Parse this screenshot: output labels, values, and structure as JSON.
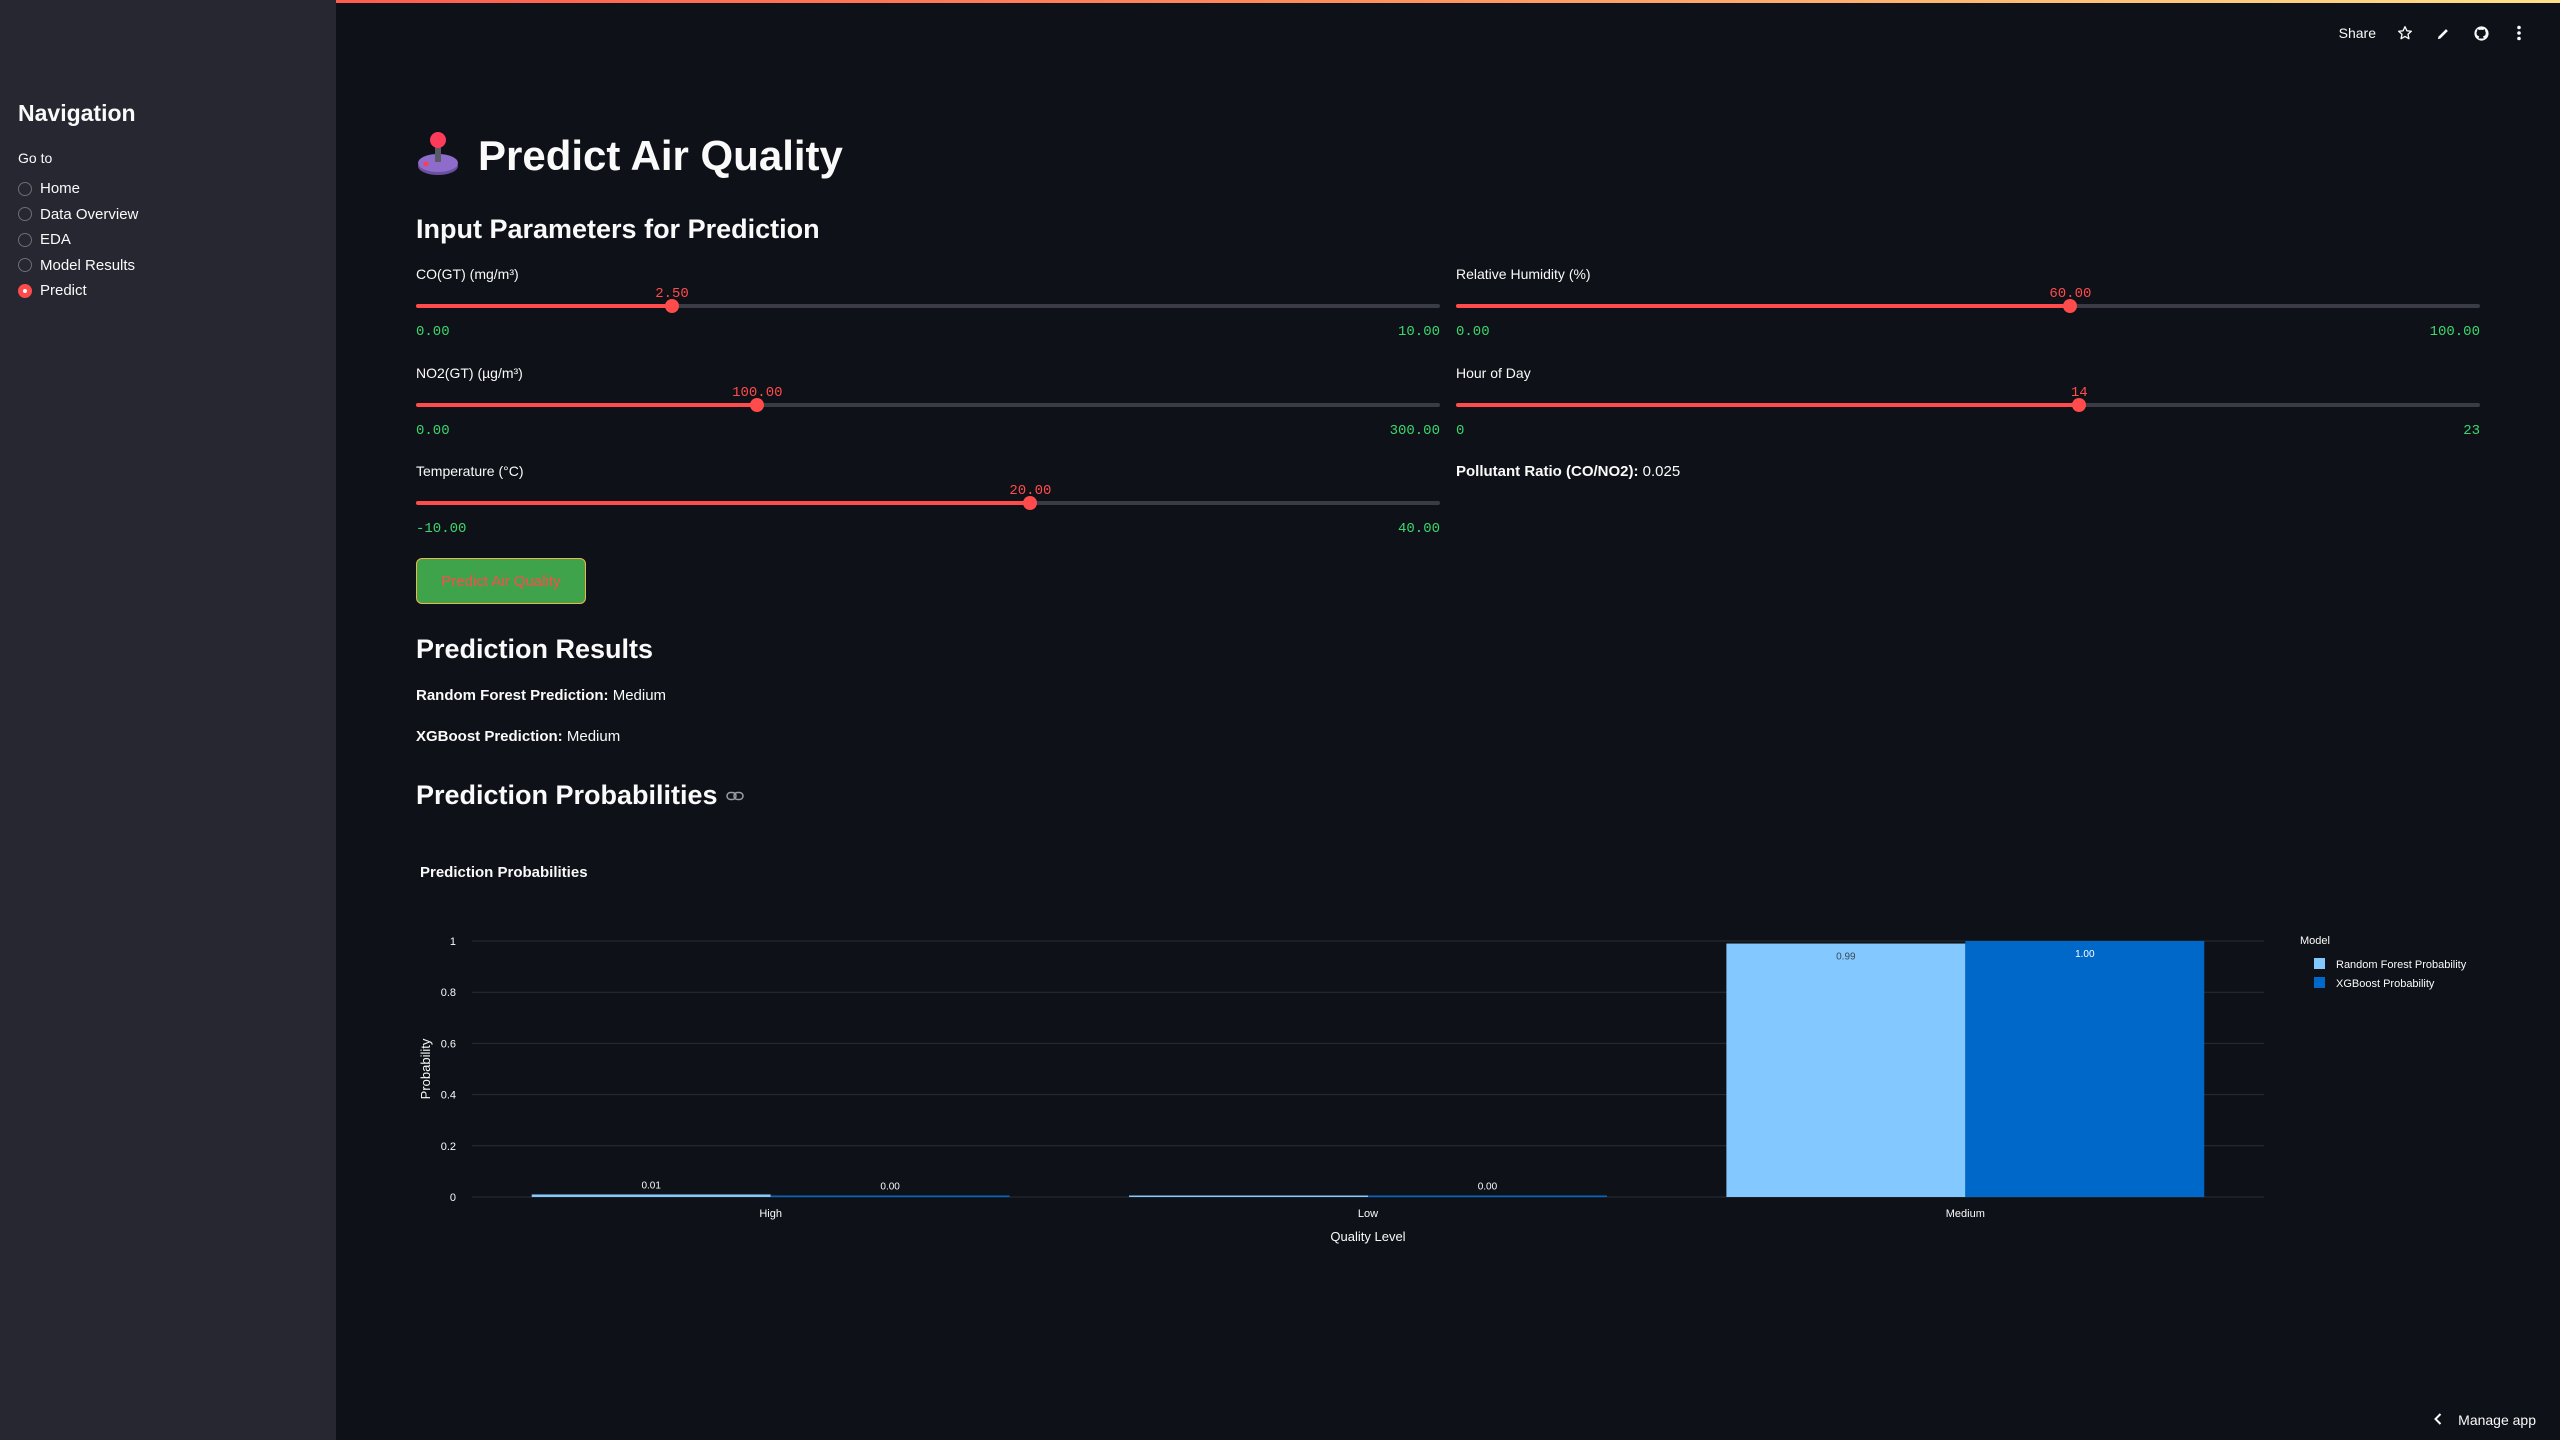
{
  "colors": {
    "accent": "#ff4b4b",
    "sidebar_bg": "#262730",
    "main_bg": "#0e1117",
    "rf_bar": "#83c9ff",
    "xgb_bar": "#0068c9",
    "minmax_text": "#3dd56d"
  },
  "sidebar": {
    "title": "Navigation",
    "goto_label": "Go to",
    "items": [
      {
        "label": "Home",
        "selected": false
      },
      {
        "label": "Data Overview",
        "selected": false
      },
      {
        "label": "EDA",
        "selected": false
      },
      {
        "label": "Model Results",
        "selected": false
      },
      {
        "label": "Predict",
        "selected": true
      }
    ]
  },
  "toolbar": {
    "share_label": "Share",
    "icons": [
      "star-icon",
      "pencil-icon",
      "github-icon",
      "more-vert-icon"
    ]
  },
  "page": {
    "title_icon": "joystick-icon",
    "title": "Predict Air Quality"
  },
  "inputs": {
    "heading": "Input Parameters for Prediction",
    "sliders": {
      "co": {
        "label": "CO(GT) (mg/m³)",
        "value": "2.50",
        "min": "0.00",
        "max": "10.00",
        "fraction": 0.25
      },
      "no2": {
        "label": "NO2(GT) (µg/m³)",
        "value": "100.00",
        "min": "0.00",
        "max": "300.00",
        "fraction": 0.3333
      },
      "temp": {
        "label": "Temperature (°C)",
        "value": "20.00",
        "min": "-10.00",
        "max": "40.00",
        "fraction": 0.6
      },
      "humidity": {
        "label": "Relative Humidity (%)",
        "value": "60.00",
        "min": "0.00",
        "max": "100.00",
        "fraction": 0.6
      },
      "hour": {
        "label": "Hour of Day",
        "value": "14",
        "min": "0",
        "max": "23",
        "fraction": 0.6087
      }
    },
    "ratio_label": "Pollutant Ratio (CO/NO2):",
    "ratio_value": "0.025",
    "predict_button": "Predict Air Quality"
  },
  "results": {
    "heading": "Prediction Results",
    "rf_label": "Random Forest Prediction:",
    "rf_value": "Medium",
    "xgb_label": "XGBoost Prediction:",
    "xgb_value": "Medium",
    "prob_heading": "Prediction Probabilities"
  },
  "chart_data": {
    "type": "bar",
    "title": "Prediction Probabilities",
    "xlabel": "Quality Level",
    "ylabel": "Probability",
    "categories": [
      "High",
      "Low",
      "Medium"
    ],
    "yticks": [
      "0",
      "0.2",
      "0.4",
      "0.6",
      "0.8",
      "1"
    ],
    "ylim": [
      0,
      1
    ],
    "legend_title": "Model",
    "legend_position": "right",
    "grid": true,
    "series": [
      {
        "name": "Random Forest Probability",
        "values": [
          0.01,
          0.0,
          0.99
        ],
        "labels": [
          "0.01",
          "",
          "0.99"
        ],
        "color": "#83c9ff"
      },
      {
        "name": "XGBoost Probability",
        "values": [
          0.0,
          0.0,
          1.0
        ],
        "labels": [
          "0.00",
          "0.00",
          "1.00"
        ],
        "color": "#0068c9"
      }
    ]
  },
  "footer": {
    "manage_label": "Manage app"
  }
}
